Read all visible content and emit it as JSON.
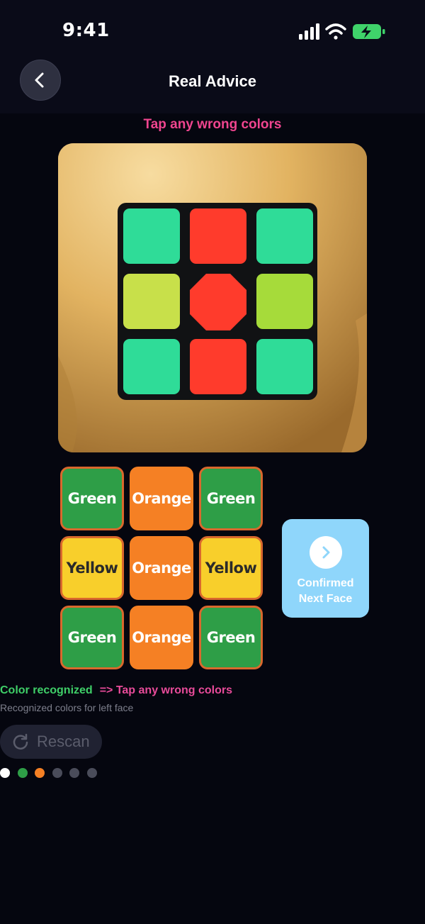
{
  "status_bar": {
    "time": "9:41",
    "icons": [
      "cellular-signal-icon",
      "wifi-icon",
      "battery-charging-icon"
    ],
    "battery_color": "#3fd36a"
  },
  "header": {
    "title": "Real Advice",
    "back_icon": "chevron-left-icon"
  },
  "hint_top": "Tap any wrong colors",
  "camera": {
    "description_colors": [
      "#2fdc98",
      "#ff3b2c",
      "#2fdc98",
      "#c8e04a",
      "#ff3b2c",
      "#a6db3a",
      "#2fdc98",
      "#ff3b2c",
      "#2fdc98"
    ]
  },
  "grid": {
    "cells": [
      {
        "label": "Green",
        "color": "green"
      },
      {
        "label": "Orange",
        "color": "orange"
      },
      {
        "label": "Green",
        "color": "green"
      },
      {
        "label": "Yellow",
        "color": "yellow"
      },
      {
        "label": "Orange",
        "color": "orange"
      },
      {
        "label": "Yellow",
        "color": "yellow"
      },
      {
        "label": "Green",
        "color": "green"
      },
      {
        "label": "Orange",
        "color": "orange"
      },
      {
        "label": "Green",
        "color": "green"
      }
    ]
  },
  "confirm": {
    "line1": "Confirmed",
    "line2": "Next Face",
    "icon": "chevron-right-circle-icon"
  },
  "recognition": {
    "status": "Color recognized",
    "hint": "=> Tap any wrong colors",
    "subtitle": "Recognized colors for left face"
  },
  "rescan": {
    "label": "Rescan",
    "icon": "refresh-icon"
  },
  "progress_dots": [
    {
      "color": "#ffffff"
    },
    {
      "color": "#2e9e47"
    },
    {
      "color": "#f58024"
    },
    {
      "color": "#4a4c5a"
    },
    {
      "color": "#4a4c5a"
    },
    {
      "color": "#4a4c5a"
    }
  ],
  "colors": {
    "accent_pink": "#f0458f",
    "accent_green": "#3fcf68",
    "confirm_blue": "#8fd6fb",
    "background": "#05060f"
  }
}
